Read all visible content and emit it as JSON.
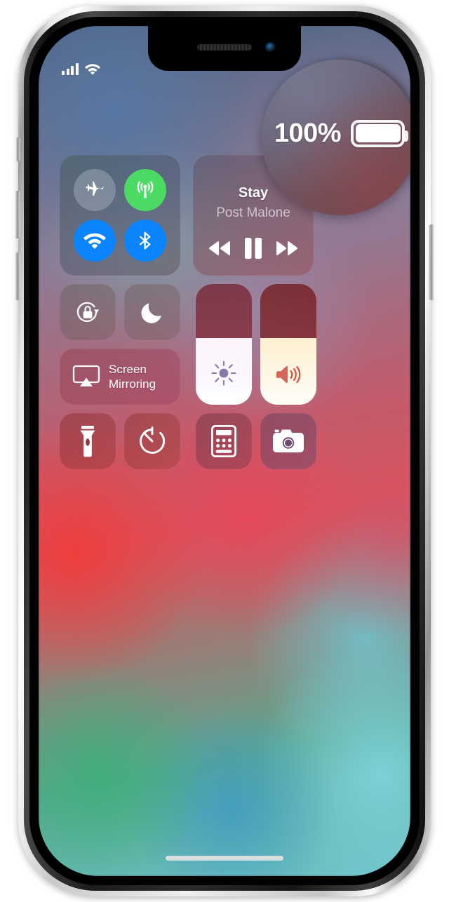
{
  "device": {
    "name": "iphone-x",
    "buttons": {
      "mute_switch": "Ring/Silent switch",
      "volume_up": "Volume Up",
      "volume_down": "Volume Down",
      "power": "Side button"
    },
    "notch": {
      "speaker": "earpiece-speaker",
      "camera": "front-camera"
    }
  },
  "status_bar": {
    "cellular_signal_bars": 4,
    "wifi_icon": "wifi-icon",
    "battery_percent_text": "100%",
    "battery_level": 100,
    "battery_charging": false
  },
  "magnifier": {
    "visible": true,
    "magnified_region": "battery-status-indicator",
    "percent_label": "100%",
    "battery_icon": "battery-full-icon"
  },
  "control_center": {
    "connectivity": {
      "module_name": "connectivity-module",
      "toggles": [
        {
          "name": "airplane-mode",
          "label": "Airplane Mode",
          "icon": "airplane-icon",
          "active": false,
          "color": "#e1ebf0"
        },
        {
          "name": "cellular-data",
          "label": "Cellular Data",
          "icon": "cellular-antenna-icon",
          "active": true,
          "color": "#4cd964"
        },
        {
          "name": "wifi",
          "label": "Wi-Fi",
          "icon": "wifi-icon",
          "active": true,
          "color": "#0a84ff"
        },
        {
          "name": "bluetooth",
          "label": "Bluetooth",
          "icon": "bluetooth-icon",
          "active": true,
          "color": "#0a84ff"
        }
      ]
    },
    "now_playing": {
      "module_name": "now-playing-module",
      "track_title": "Stay",
      "artist": "Post Malone",
      "airplay_icon": "airplay-audio-icon",
      "controls": [
        {
          "name": "rewind-button",
          "icon": "rewind-icon",
          "label": "Rewind"
        },
        {
          "name": "pause-button",
          "icon": "pause-icon",
          "label": "Pause"
        },
        {
          "name": "fast-forward-button",
          "icon": "fast-forward-icon",
          "label": "Fast Forward"
        }
      ]
    },
    "rotation_lock": {
      "label": "Portrait Orientation Lock",
      "icon": "rotation-lock-icon",
      "active": false
    },
    "do_not_disturb": {
      "label": "Do Not Disturb",
      "icon": "moon-icon",
      "active": false
    },
    "screen_mirroring": {
      "label_line1": "Screen",
      "label_line2": "Mirroring",
      "icon": "airplay-screen-icon"
    },
    "brightness_slider": {
      "label": "Brightness",
      "icon": "brightness-sun-icon",
      "value_percent": 55
    },
    "volume_slider": {
      "label": "Volume",
      "icon": "speaker-waves-icon",
      "value_percent": 55
    },
    "utilities": [
      {
        "name": "flashlight",
        "label": "Flashlight",
        "icon": "flashlight-icon"
      },
      {
        "name": "timer",
        "label": "Timer",
        "icon": "timer-icon"
      },
      {
        "name": "calculator",
        "label": "Calculator",
        "icon": "calculator-icon"
      },
      {
        "name": "camera",
        "label": "Camera",
        "icon": "camera-icon"
      }
    ]
  },
  "home_indicator": {
    "label": "Home indicator"
  }
}
